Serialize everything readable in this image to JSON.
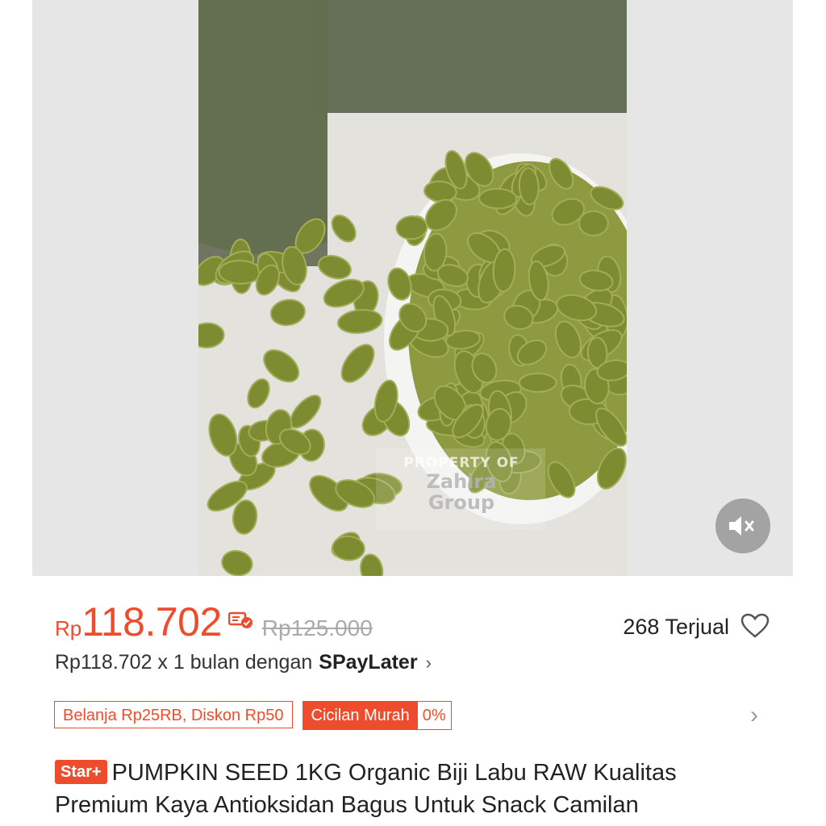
{
  "media": {
    "watermark_top": "PROPERTY OF",
    "watermark_brand_line1": "Zahira",
    "watermark_brand_line2": "Group",
    "mute_icon": "speaker-muted-icon"
  },
  "price": {
    "currency": "Rp",
    "value": "118.702",
    "original": "Rp125.000",
    "voucher_icon": "voucher-check-icon"
  },
  "sold": "268 Terjual",
  "paylater": {
    "text": "Rp118.702 x 1 bulan dengan",
    "brand": "SPayLater",
    "chevron": "›"
  },
  "promos": {
    "discount": "Belanja Rp25RB, Diskon Rp50",
    "installment_label": "Cicilan Murah",
    "installment_rate": "0%",
    "chevron": "›"
  },
  "product": {
    "badge": "Star+",
    "title": "PUMPKIN SEED 1KG Organic Biji Labu RAW Kualitas Premium Kaya Antioksidan Bagus Untuk Snack Camilan"
  },
  "colors": {
    "accent": "#ee4d2d",
    "seed": "#8c9a3a"
  }
}
